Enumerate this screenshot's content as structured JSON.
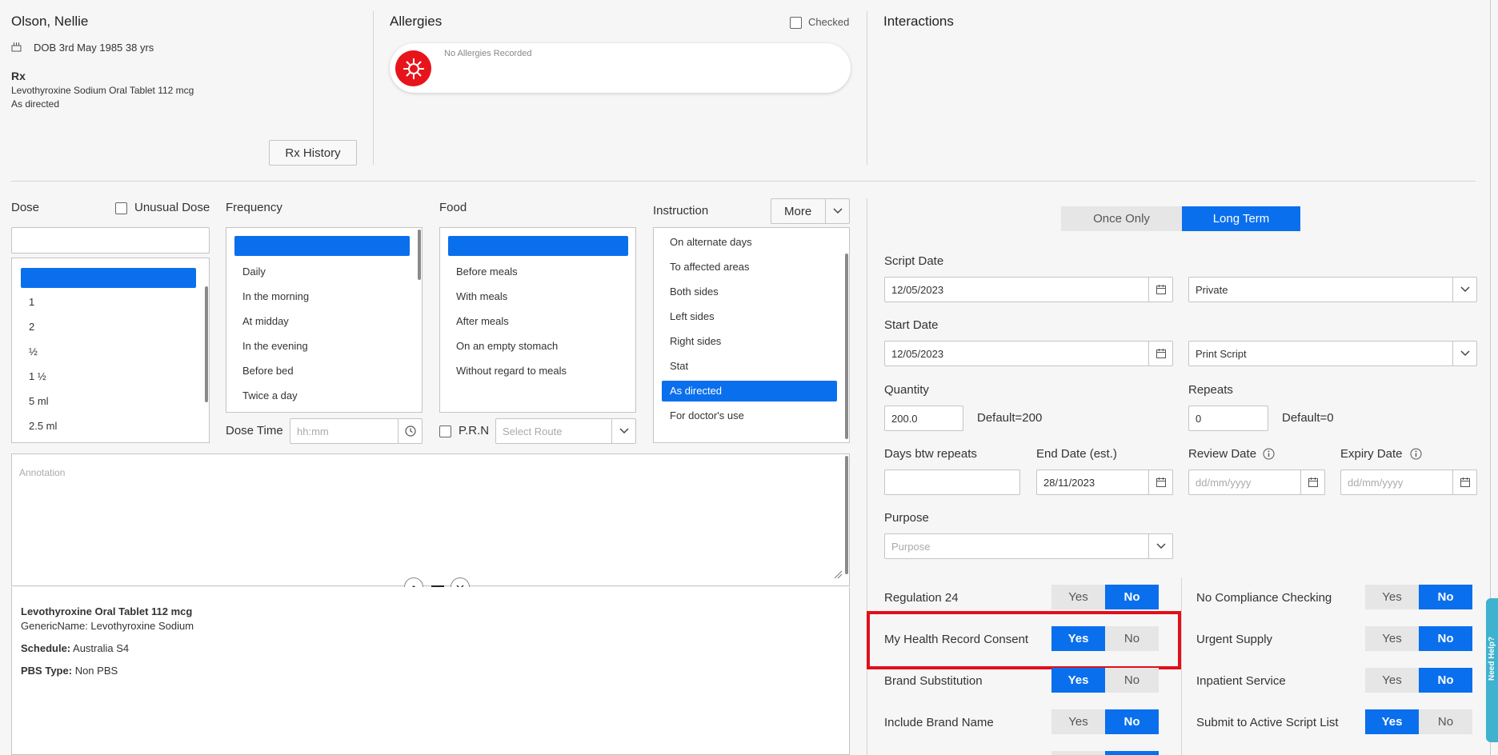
{
  "patient": {
    "name": "Olson, Nellie",
    "dob": "DOB 3rd May 1985 38 yrs",
    "rx_heading": "Rx",
    "rx_drug": "Levothyroxine Sodium Oral Tablet 112 mcg",
    "rx_directions": "As directed",
    "rx_history_button": "Rx History"
  },
  "allergies": {
    "title": "Allergies",
    "checked_label": "Checked",
    "empty_text": "No Allergies Recorded"
  },
  "interactions": {
    "title": "Interactions"
  },
  "dose": {
    "label": "Dose",
    "unusual_label": "Unusual Dose",
    "items": [
      "1",
      "2",
      "½",
      "1 ½",
      "5 ml",
      "2.5 ml"
    ]
  },
  "frequency": {
    "label": "Frequency",
    "items": [
      "Daily",
      "In the morning",
      "At midday",
      "In the evening",
      "Before bed",
      "Twice a day"
    ],
    "dose_time_label": "Dose Time",
    "dose_time_placeholder": "hh:mm"
  },
  "food": {
    "label": "Food",
    "items": [
      "Before meals",
      "With meals",
      "After meals",
      "On an empty stomach",
      "Without regard to meals"
    ],
    "prn_label": "P.R.N",
    "route_placeholder": "Select Route"
  },
  "instruction": {
    "label": "Instruction",
    "more_button": "More",
    "items": [
      "On alternate days",
      "To affected areas",
      "Both sides",
      "Left sides",
      "Right sides",
      "Stat",
      "As directed",
      "For doctor's use"
    ],
    "selected": "As directed"
  },
  "annotation": {
    "placeholder": "Annotation"
  },
  "drug_info": {
    "name": "Levothyroxine Oral Tablet 112 mcg",
    "generic_line": "GenericName: Levothyroxine Sodium",
    "schedule_label": "Schedule:",
    "schedule_value": "Australia S4",
    "pbs_label": "PBS Type:",
    "pbs_value": "Non PBS"
  },
  "script": {
    "mode_once": "Once Only",
    "mode_long": "Long Term",
    "mode_selected": "Long Term",
    "script_date_label": "Script Date",
    "script_date": "12/05/2023",
    "payment_type": "Private",
    "start_date_label": "Start Date",
    "start_date": "12/05/2023",
    "print_option": "Print Script",
    "quantity_label": "Quantity",
    "quantity": "200.0",
    "quantity_default": "Default=200",
    "repeats_label": "Repeats",
    "repeats": "0",
    "repeats_default": "Default=0",
    "days_btw_label": "Days btw repeats",
    "days_btw": "",
    "end_date_label": "End Date (est.)",
    "end_date": "28/11/2023",
    "review_date_label": "Review Date",
    "expiry_date_label": "Expiry Date",
    "date_placeholder": "dd/mm/yyyy",
    "purpose_label": "Purpose",
    "purpose_placeholder": "Purpose"
  },
  "toggles": {
    "yes": "Yes",
    "no": "No",
    "left": [
      {
        "label": "Regulation 24",
        "value": "No"
      },
      {
        "label": "My Health Record Consent",
        "value": "Yes"
      },
      {
        "label": "Brand Substitution",
        "value": "Yes"
      },
      {
        "label": "Include Brand Name",
        "value": "No"
      }
    ],
    "right": [
      {
        "label": "No Compliance Checking",
        "value": "No"
      },
      {
        "label": "Urgent Supply",
        "value": "No"
      },
      {
        "label": "Inpatient Service",
        "value": "No"
      },
      {
        "label": "Submit to Active Script List",
        "value": "Yes"
      }
    ]
  },
  "help_tab": "Need Help?",
  "colors": {
    "accent": "#0a6fed",
    "highlight": "#e0101a",
    "allergy_icon": "#e8141b"
  }
}
